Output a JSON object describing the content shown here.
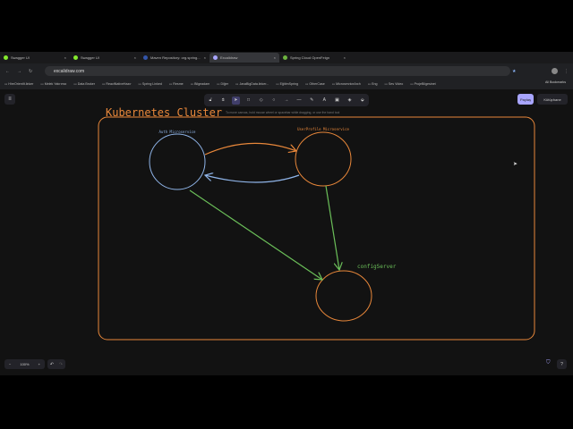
{
  "tabs": [
    {
      "label": "Swagger UI",
      "color": "#85ea2d"
    },
    {
      "label": "Swagger UI",
      "color": "#85ea2d"
    },
    {
      "label": "Maven Repository: org.spring...",
      "color": "#3355aa"
    },
    {
      "label": "Excalidraw",
      "color": "#a8a5ff"
    },
    {
      "label": "Spring Cloud OpenFeign",
      "color": "#6db33f"
    }
  ],
  "url": "excalidraw.com",
  "bookmarks": [
    "HireOrientIt.linker",
    "Melek Yatırımcı",
    "Data Broker",
    "ReactNativeHazır",
    "Spring Linked",
    "Resme",
    "Bilgeadam",
    "Diğer",
    "JavaBigData.linker...",
    "EğitimSpring",
    "OtherCase",
    "MicroserviceArch",
    "Eng",
    "Ses Video",
    "ProjeBilgesinet"
  ],
  "all_bookmarks": "All Bookmarks",
  "toolbar_hint": "To move canvas, hold mouse wheel or spacebar while dragging, or use the hand tool",
  "share_label": "Paylaş",
  "library_label": "Kütüphane",
  "zoom_level": "100%",
  "diagram": {
    "title": "Kubernetes Cluster",
    "auth": "Auth Microservice",
    "user": "UserProfile Microservice",
    "config": "configServer"
  },
  "colors": {
    "orange": "#e8873a",
    "blue": "#8fb4e8",
    "green": "#6bbf59"
  }
}
